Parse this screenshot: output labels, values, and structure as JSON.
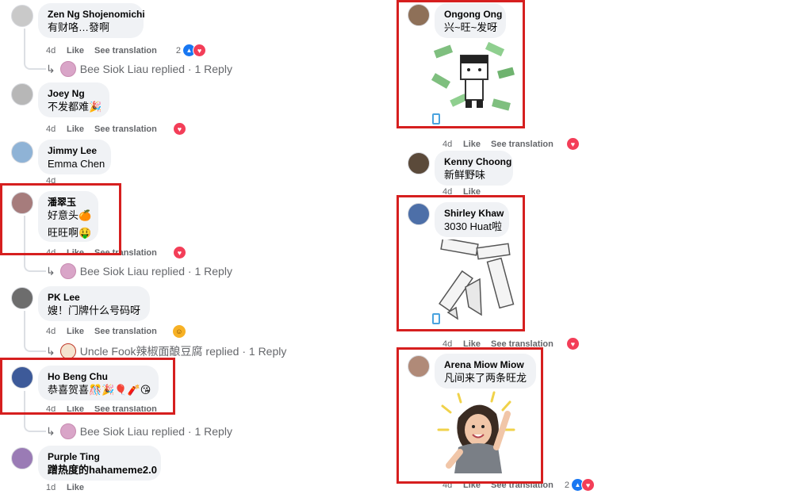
{
  "labels": {
    "like": "Like",
    "see_translation": "See translation"
  },
  "left_comments": [
    {
      "name": "Zen Ng Shojenomichi",
      "text": "有财咯…發啊",
      "time": "4d",
      "reaction_count": "2"
    },
    {
      "name": "Joey Ng",
      "text": "不发都难🎉",
      "time": "4d"
    },
    {
      "name": "Jimmy Lee",
      "text": "Emma Chen",
      "time": "4d"
    },
    {
      "name": "潘翠玉",
      "text": "好意头🍊",
      "text2": "旺旺啊🤑",
      "time": "4d"
    },
    {
      "name": "PK Lee",
      "text": "嫂！门牌什么号码呀",
      "time": "4d"
    },
    {
      "name": "Ho Beng Chu",
      "text": "恭喜贺喜🎊🎉🎈🧨😘",
      "time": "4d"
    },
    {
      "name": "Purple Ting",
      "text": "蹭热度的hahameme2.0",
      "time": "1d"
    }
  ],
  "replies": [
    {
      "text": "Bee Siok Liau replied · 1 Reply"
    },
    {
      "text": "Bee Siok Liau replied · 1 Reply"
    },
    {
      "text": "Uncle Fook辣椒面酿豆腐 replied · 1 Reply"
    },
    {
      "text": "Bee Siok Liau replied · 1 Reply"
    }
  ],
  "right_comments": [
    {
      "name": "Ongong Ong",
      "text": "兴~旺~发呀",
      "time": "4d"
    },
    {
      "name": "Kenny Choong",
      "text": "新鲜野味",
      "time": "4d"
    },
    {
      "name": "Shirley Khaw",
      "text": "3030 Huat啦",
      "time": "4d"
    },
    {
      "name": "Arena Miow Miow",
      "text": "凡间来了两条旺龙",
      "time": "4d",
      "reaction_count": "2"
    }
  ],
  "colors": {
    "highlight": "#d61f1f",
    "bubble": "#f0f2f5",
    "meta": "#65676b",
    "heart": "#f33e58",
    "like": "#1877f2"
  }
}
